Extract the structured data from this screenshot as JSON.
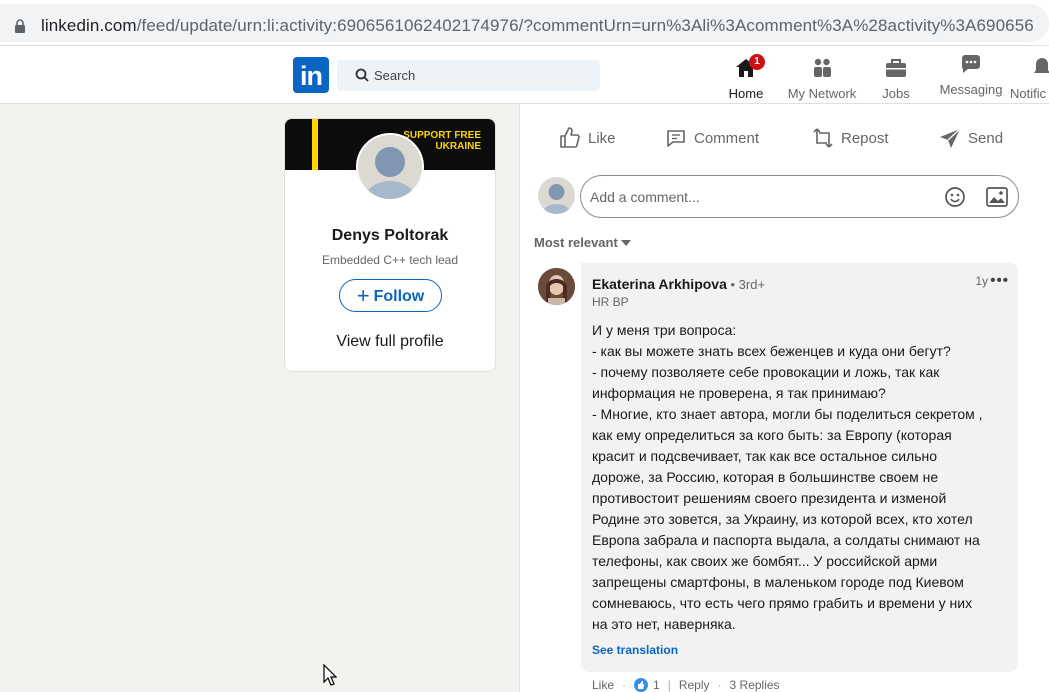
{
  "browser": {
    "url_main": "linkedin.com",
    "url_rest": "/feed/update/urn:li:activity:6906561062402174976/?commentUrn=urn%3Ali%3Acomment%3A%28activity%3A690656"
  },
  "nav": {
    "search_placeholder": "Search",
    "items": [
      {
        "label": "Home",
        "badge": "1"
      },
      {
        "label": "My Network"
      },
      {
        "label": "Jobs"
      },
      {
        "label": "Messaging"
      },
      {
        "label": "Notific"
      }
    ]
  },
  "profile": {
    "banner_line1": "SUPPORT FREE",
    "banner_line2": "UKRAINE",
    "name": "Denys Poltorak",
    "headline": "Embedded C++ tech lead",
    "follow_label": "Follow",
    "view_profile_label": "View full profile"
  },
  "actions": {
    "like": "Like",
    "comment": "Comment",
    "repost": "Repost",
    "send": "Send"
  },
  "comment_box": {
    "placeholder": "Add a comment..."
  },
  "sort_label": "Most relevant",
  "comment": {
    "author": "Ekaterina Arkhipova",
    "degree": " • 3rd+",
    "role": "HR BP",
    "time": "1y",
    "more": "•••",
    "lines": [
      "И у меня три вопроса:",
      "- как вы можете знать всех беженцев и куда они бегут?",
      "- почему позволяете себе провокации и ложь, так как",
      "информация не проверена, я так принимаю?",
      "- Многие, кто знает автора, могли бы поделиться секретом ,",
      "как ему определиться за кого быть: за Европу (которая",
      "красит и подсвечивает, так как все остальное сильно",
      "дороже, за Россию, которая в большинстве своем не",
      "противостоит решениям своего президента и изменой",
      "Родине это зовется, за Украину, из которой всех, кто хотел",
      "Европа забрала и паспорта выдала, а солдаты снимают на",
      "телефоны, как своих же бомбят... У российской арми",
      "запрещены смартфоны, в маленьком городе под Киевом",
      "сомневаюсь, что есть чего прямо грабить и времени у них",
      "на это нет, наверняка."
    ],
    "see_translation": "See translation",
    "like_label": "Like",
    "like_count": "1",
    "reply_label": "Reply",
    "replies_label": "3 Replies"
  }
}
